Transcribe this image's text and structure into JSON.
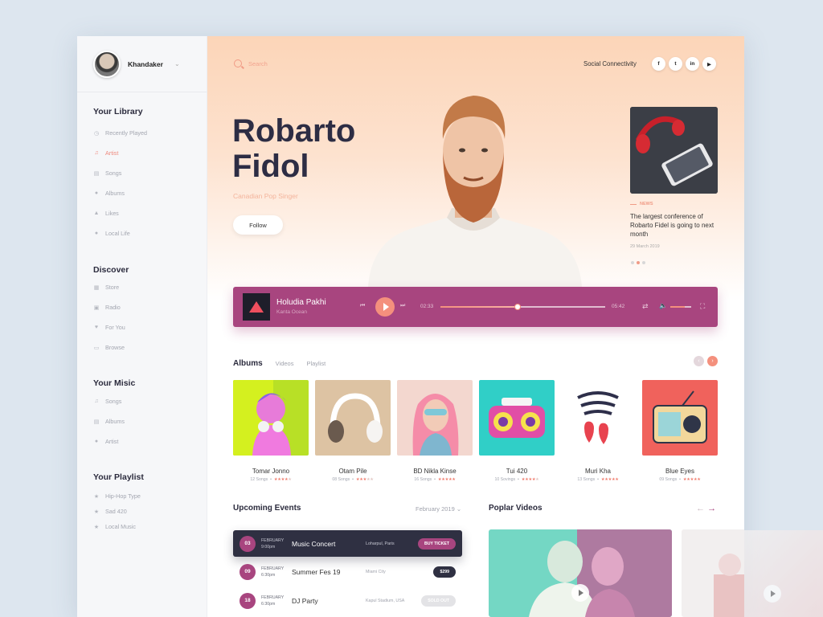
{
  "user": {
    "name": "Khandaker"
  },
  "sidebar": {
    "library": {
      "title": "Your Library",
      "items": [
        "Recently Played",
        "Artist",
        "Songs",
        "Albums",
        "Likes",
        "Local Life"
      ]
    },
    "discover": {
      "title": "Discover",
      "items": [
        "Store",
        "Radio",
        "For You",
        "Browse"
      ]
    },
    "music": {
      "title": "Your Misic",
      "items": [
        "Songs",
        "Albums",
        "Artist"
      ]
    },
    "playlist": {
      "title": "Your Playlist",
      "items": [
        "Hip-Hop Type",
        "Sad 420",
        "Local Music"
      ]
    }
  },
  "header": {
    "search_placeholder": "Search",
    "social_label": "Social Connectivity",
    "social": [
      "f",
      "t",
      "in",
      "yt"
    ]
  },
  "hero": {
    "name_line1": "Robarto",
    "name_line2": "Fidol",
    "subtitle": "Canadian Pop Singer",
    "follow": "Follow"
  },
  "news": {
    "tag": "NEWS",
    "text": "The largest conference of Robarto Fidel  is going to next month",
    "date": "29 March 2019"
  },
  "player": {
    "title": "Holudia Pakhi",
    "artist": "Kanta Ocean",
    "elapsed": "02:33",
    "total": "05:42",
    "progress": 0.47,
    "volume": 0.7
  },
  "albums_section": {
    "tabs": [
      "Albums",
      "Videos",
      "Playlist"
    ]
  },
  "albums": [
    {
      "name": "Tomar Jonno",
      "songs": "12 Songs",
      "rating": 4
    },
    {
      "name": "Otam Pile",
      "songs": "08 Songs",
      "rating": 3
    },
    {
      "name": "BD Nikla Kinse",
      "songs": "16 Songs",
      "rating": 5
    },
    {
      "name": "Tui 420",
      "songs": "10 Sovings",
      "rating": 4
    },
    {
      "name": "Muri Kha",
      "songs": "13 Songs",
      "rating": 5
    },
    {
      "name": "Blue Eyes",
      "songs": "09 Songs",
      "rating": 5
    }
  ],
  "events": {
    "title": "Upcoming Events",
    "month": "February 2019",
    "items": [
      {
        "day": "03",
        "month": "FEBRUARY",
        "time": "9:00pm",
        "name": "Music Concert",
        "location": "Loharpul, Paris",
        "action": "BUY TICKET"
      },
      {
        "day": "09",
        "month": "FEBRUARY",
        "time": "6:30pm",
        "name": "Summer Fes 19",
        "location": "Miami City",
        "action": "$299"
      },
      {
        "day": "18",
        "month": "FEBRUARY",
        "time": "6:30pm",
        "name": "DJ Party",
        "location": "Kapul Stadium, USA",
        "action": "SOLD OUT"
      }
    ]
  },
  "videos": {
    "title": "Poplar Videos"
  }
}
